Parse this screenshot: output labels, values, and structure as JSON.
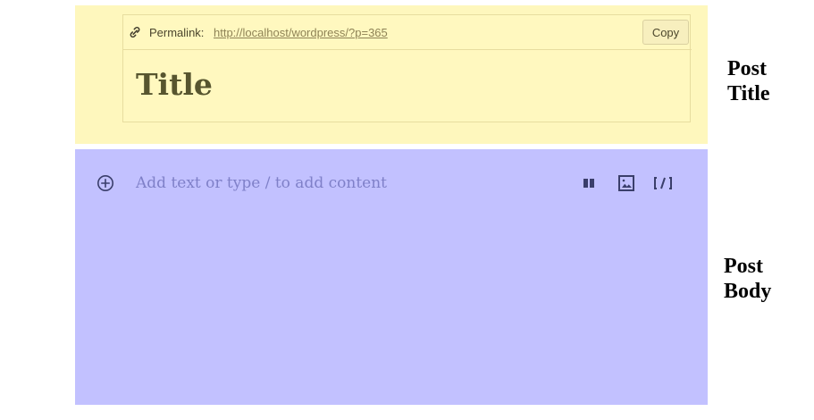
{
  "title_section": {
    "permalink_label": "Permalink:",
    "permalink_url": "http://localhost/wordpress/?p=365",
    "copy_label": "Copy",
    "title_text": "Title",
    "side_label_line1": "Post",
    "side_label_line2": "Title"
  },
  "body_section": {
    "placeholder": "Add text or type / to add content",
    "side_label_line1": "Post",
    "side_label_line2": "Body",
    "toolbar_icons": [
      "columns-icon",
      "image-icon",
      "shortcode-icon"
    ]
  },
  "colors": {
    "title_background": "#fef7bd",
    "body_background": "#c2c1ff",
    "placeholder_text": "#7f80c8"
  }
}
